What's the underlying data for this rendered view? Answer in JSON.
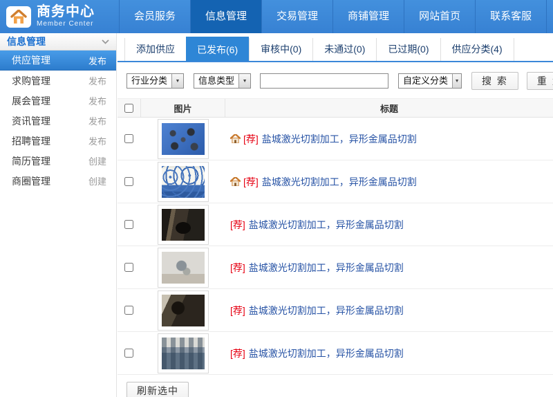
{
  "header": {
    "logo": {
      "title": "商务中心",
      "subtitle": "Member Center",
      "icon": "home-icon"
    },
    "nav": [
      {
        "label": "会员服务",
        "active": false
      },
      {
        "label": "信息管理",
        "active": true
      },
      {
        "label": "交易管理",
        "active": false
      },
      {
        "label": "商铺管理",
        "active": false
      },
      {
        "label": "网站首页",
        "active": false
      },
      {
        "label": "联系客服",
        "active": false
      }
    ]
  },
  "sidebar": {
    "group_title": "信息管理",
    "group_chevron_icon": "chevron-down-icon",
    "items": [
      {
        "label": "供应管理",
        "action": "发布",
        "active": true
      },
      {
        "label": "求购管理",
        "action": "发布",
        "active": false
      },
      {
        "label": "展会管理",
        "action": "发布",
        "active": false
      },
      {
        "label": "资讯管理",
        "action": "发布",
        "active": false
      },
      {
        "label": "招聘管理",
        "action": "发布",
        "active": false
      },
      {
        "label": "简历管理",
        "action": "创建",
        "active": false
      },
      {
        "label": "商圈管理",
        "action": "创建",
        "active": false
      }
    ]
  },
  "tabs": [
    {
      "label": "添加供应",
      "active": false
    },
    {
      "label": "已发布(6)",
      "active": true,
      "count": 6
    },
    {
      "label": "审核中(0)",
      "active": false,
      "count": 0
    },
    {
      "label": "未通过(0)",
      "active": false,
      "count": 0
    },
    {
      "label": "已过期(0)",
      "active": false,
      "count": 0
    },
    {
      "label": "供应分类(4)",
      "active": false,
      "count": 4
    }
  ],
  "filters": {
    "industry_select": "行业分类",
    "type_select": "信息类型",
    "keyword_input": {
      "value": "",
      "placeholder": ""
    },
    "custom_select": "自定义分类",
    "search_button": "搜 索",
    "reset_button": "重 置",
    "dropdown_icon": "dropdown-arrow-icon"
  },
  "table": {
    "columns": {
      "image": "图片",
      "title": "标题"
    },
    "rows": [
      {
        "badge": "[荐]",
        "title": "盐城激光切割加工，异形金属品切割",
        "has_home_icon": true,
        "thumb": "blue-metal-cut-pieces"
      },
      {
        "badge": "[荐]",
        "title": "盐城激光切割加工，异形金属品切割",
        "has_home_icon": true,
        "thumb": "blue-white-carved-panel"
      },
      {
        "badge": "[荐]",
        "title": "盐城激光切割加工，异形金属品切割",
        "has_home_icon": false,
        "thumb": "dark-metal-fan-carving"
      },
      {
        "badge": "[荐]",
        "title": "盐城激光切割加工，异形金属品切割",
        "has_home_icon": false,
        "thumb": "light-workshop-piece"
      },
      {
        "badge": "[荐]",
        "title": "盐城激光切割加工，异形金属品切割",
        "has_home_icon": false,
        "thumb": "dark-interior-sculpture"
      },
      {
        "badge": "[荐]",
        "title": "盐城激光切割加工，异形金属品切割",
        "has_home_icon": false,
        "thumb": "outdoor-metal-drums"
      }
    ]
  },
  "footer": {
    "refresh_button": "刷新选中"
  },
  "colors": {
    "header_blue": "#3a87d8",
    "active_nav_blue": "#1463b2",
    "active_tab_blue": "#2e86d6",
    "link_blue": "#2753a5",
    "badge_red": "#e60012"
  }
}
